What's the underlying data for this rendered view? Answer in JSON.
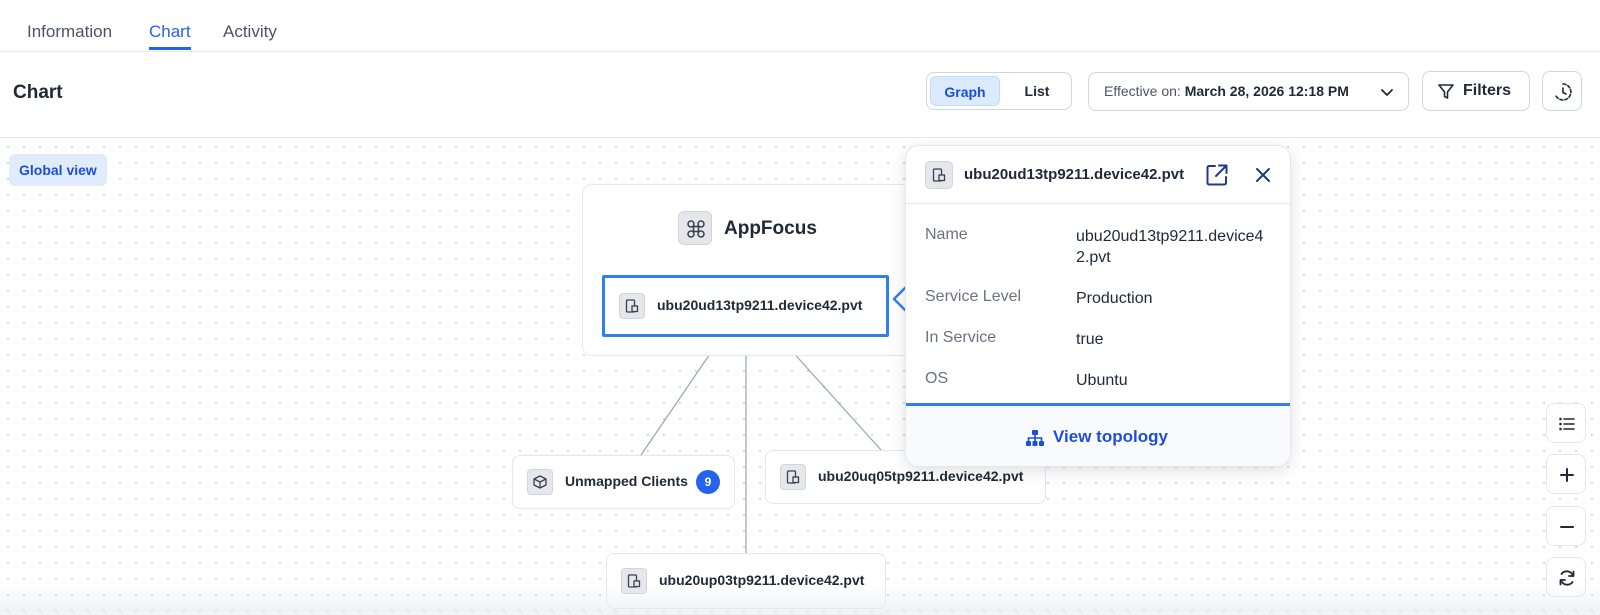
{
  "tabs": [
    {
      "label": "Information"
    },
    {
      "label": "Chart"
    },
    {
      "label": "Activity"
    }
  ],
  "toolbar": {
    "title": "Chart",
    "view_toggle": {
      "graph_label": "Graph",
      "list_label": "List",
      "selected": "Graph"
    },
    "effective": {
      "label": "Effective on: ",
      "value": "March 28, 2026 12:18 PM"
    },
    "filters_label": "Filters"
  },
  "canvas": {
    "global_view_label": "Global view",
    "group": {
      "title": "AppFocus"
    },
    "nodes": {
      "selected": "ubu20ud13tp9211.device42.pvt",
      "unmapped": {
        "label": "Unmapped Clients",
        "count": "9"
      },
      "node_b": "ubu20uq05tp9211.device42.pvt",
      "node_c": "ubu20up03tp9211.device42.pvt"
    }
  },
  "popover": {
    "title": "ubu20ud13tp9211.device42.pvt",
    "properties": [
      {
        "label": "Name",
        "value": "ubu20ud13tp9211.device42.pvt"
      },
      {
        "label": "Service Level",
        "value": "Production"
      },
      {
        "label": "In Service",
        "value": "true"
      },
      {
        "label": "OS",
        "value": "Ubuntu"
      }
    ],
    "footer_label": "View topology"
  },
  "colors": {
    "accent": "#2563eb",
    "selected_border": "#2f80ed",
    "badge": "#2563eb"
  },
  "icons": [
    "filter-icon",
    "chevron-down-icon",
    "history-icon",
    "app-group-icon",
    "device-icon",
    "box-icon",
    "open-external-icon",
    "close-icon",
    "topology-icon",
    "legend-list-icon",
    "zoom-in-icon",
    "zoom-out-icon",
    "refresh-icon"
  ]
}
